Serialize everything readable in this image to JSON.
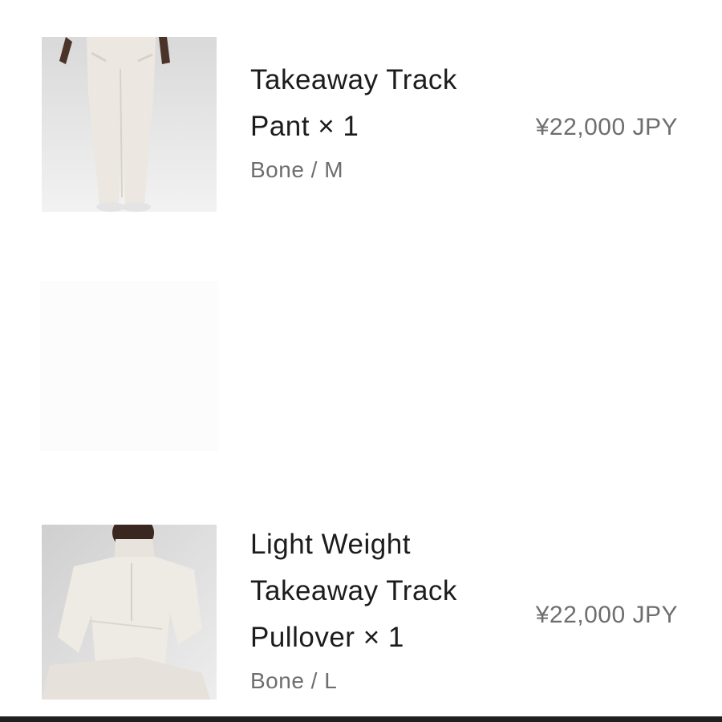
{
  "cart": {
    "items": [
      {
        "title_line1": "Takeaway Track",
        "title_line2": "Pant",
        "qty_label": "× 1",
        "variant": "Bone / M",
        "price": "¥22,000 JPY",
        "image_icon": "track-pant-photo"
      },
      {
        "title_line1": "Light Weight",
        "title_line2": "Takeaway Track",
        "title_line3": "Pullover",
        "qty_label": "× 1",
        "variant": "Bone / L",
        "price": "¥22,000 JPY",
        "image_icon": "track-pullover-photo"
      }
    ]
  },
  "colors": {
    "text_primary": "#1c1c1c",
    "text_secondary": "#6e6e6e",
    "background": "#ffffff",
    "product_bone": "#ece8e1"
  }
}
